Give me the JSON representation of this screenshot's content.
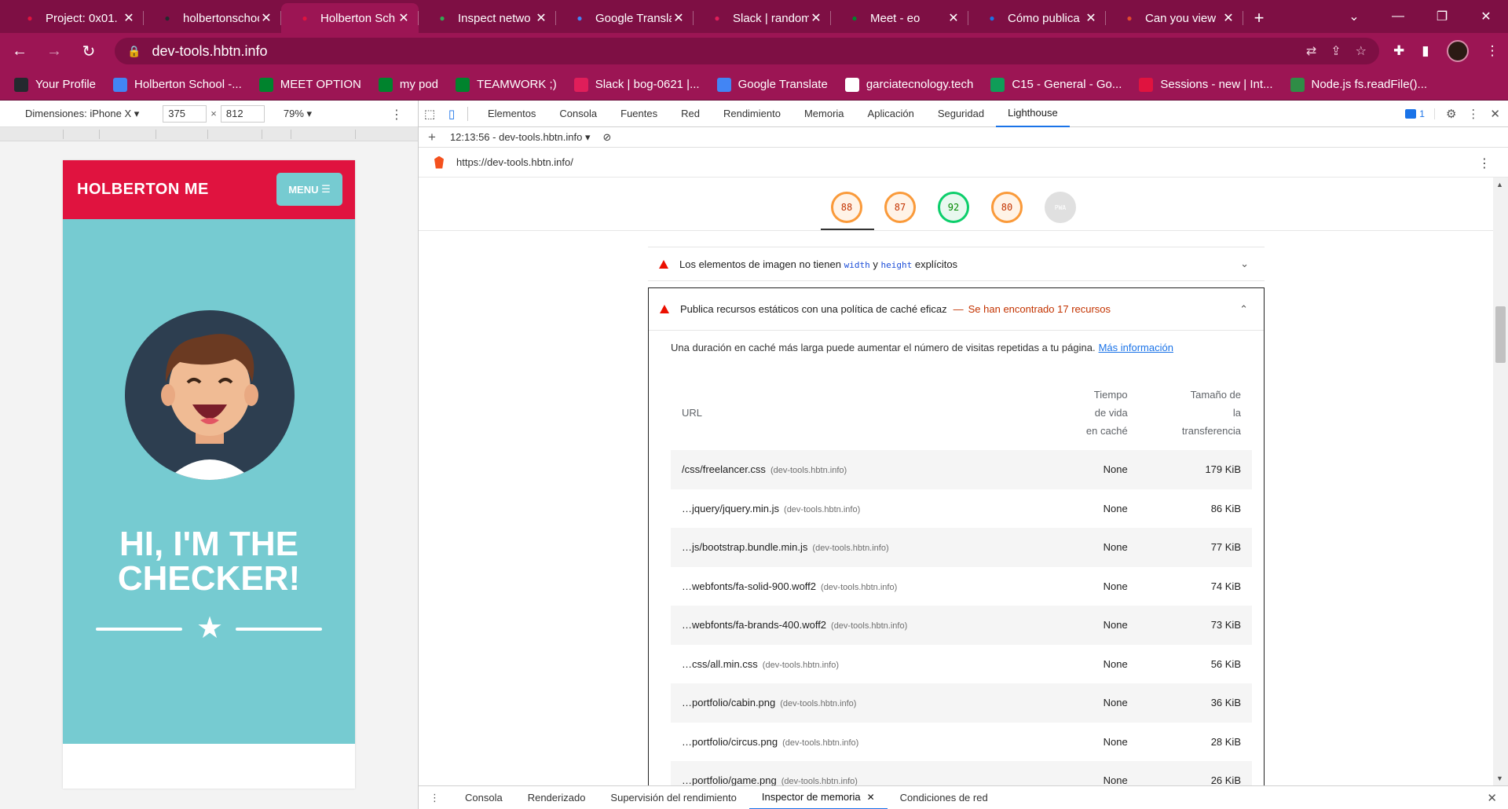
{
  "browser": {
    "tabs": [
      {
        "label": "Project: 0x01. |",
        "favicon": "holberton-icon",
        "color": "#e0133f"
      },
      {
        "label": "holbertonschool",
        "favicon": "github-icon",
        "color": "#24292e"
      },
      {
        "label": "Holberton Sch",
        "favicon": "holberton-icon",
        "color": "#e0133f",
        "active": true
      },
      {
        "label": "Inspect netwo",
        "favicon": "chrome-icon",
        "color": "#34a853"
      },
      {
        "label": "Google Transla",
        "favicon": "translate-icon",
        "color": "#4285f4"
      },
      {
        "label": "Slack | random",
        "favicon": "slack-icon",
        "color": "#e01e5a"
      },
      {
        "label": "Meet - eo",
        "favicon": "meet-icon",
        "color": "#00832d"
      },
      {
        "label": "Cómo publica",
        "favicon": "blue-circle-icon",
        "color": "#1a73e8"
      },
      {
        "label": "Can you view",
        "favicon": "asterisk-icon",
        "color": "#e2492f"
      }
    ],
    "address": "dev-tools.hbtn.info",
    "bookmarks": [
      {
        "label": "Your Profile",
        "icon": "github-icon",
        "color": "#24292e"
      },
      {
        "label": "Holberton School -...",
        "icon": "calendar-icon",
        "color": "#4285f4"
      },
      {
        "label": "MEET OPTION",
        "icon": "meet-icon",
        "color": "#00832d"
      },
      {
        "label": "my pod",
        "icon": "meet-icon",
        "color": "#00832d"
      },
      {
        "label": "TEAMWORK ;)",
        "icon": "meet-icon",
        "color": "#00832d"
      },
      {
        "label": "Slack | bog-0621 |...",
        "icon": "slack-icon",
        "color": "#e01e5a"
      },
      {
        "label": "Google Translate",
        "icon": "translate-icon",
        "color": "#4285f4"
      },
      {
        "label": "garciatecnology.tech",
        "icon": "globe-icon",
        "color": "#ffffff"
      },
      {
        "label": "C15 - General - Go...",
        "icon": "sheets-icon",
        "color": "#0f9d58"
      },
      {
        "label": "Sessions - new | Int...",
        "icon": "holberton-icon",
        "color": "#e0133f"
      },
      {
        "label": "Node.js fs.readFile()...",
        "icon": "geeks-icon",
        "color": "#2f8d46"
      }
    ]
  },
  "device": {
    "label": "Dimensiones: iPhone X",
    "width": "375",
    "height": "812",
    "zoom": "79%"
  },
  "page": {
    "brand": "HOLBERTON ME",
    "menu_label": "MENU",
    "hero_line1": "HI, I'M THE",
    "hero_line2": "CHECKER!"
  },
  "devtools": {
    "tabs": [
      "Elementos",
      "Consola",
      "Fuentes",
      "Red",
      "Rendimiento",
      "Memoria",
      "Aplicación",
      "Seguridad",
      "Lighthouse"
    ],
    "active_tab": "Lighthouse",
    "issues_count": "1",
    "report_label": "12:13:56 - dev-tools.hbtn.info",
    "report_url": "https://dev-tools.hbtn.info/",
    "scores": [
      {
        "value": "88",
        "status": "average"
      },
      {
        "value": "87",
        "status": "average"
      },
      {
        "value": "92",
        "status": "pass"
      },
      {
        "value": "80",
        "status": "average"
      },
      {
        "value": "PWA",
        "status": "na"
      }
    ],
    "audit_closed": {
      "text_before": "Los elementos de imagen no tienen",
      "code1": "width",
      "text_mid": "y",
      "code2": "height",
      "text_after": "explícitos"
    },
    "audit_open": {
      "title": "Publica recursos estáticos con una política de caché eficaz",
      "found": "Se han encontrado 17 recursos",
      "description": "Una duración en caché más larga puede aumentar el número de visitas repetidas a tu página.",
      "link": "Más información",
      "columns": {
        "url": "URL",
        "ttl": [
          "Tiempo",
          "de vida",
          "en caché"
        ],
        "size": [
          "Tamaño de",
          "la",
          "transferencia"
        ]
      },
      "rows": [
        {
          "url": "/css/freelancer.css",
          "host": "(dev-tools.hbtn.info)",
          "ttl": "None",
          "size": "179 KiB"
        },
        {
          "url": "…jquery/jquery.min.js",
          "host": "(dev-tools.hbtn.info)",
          "ttl": "None",
          "size": "86 KiB"
        },
        {
          "url": "…js/bootstrap.bundle.min.js",
          "host": "(dev-tools.hbtn.info)",
          "ttl": "None",
          "size": "77 KiB"
        },
        {
          "url": "…webfonts/fa-solid-900.woff2",
          "host": "(dev-tools.hbtn.info)",
          "ttl": "None",
          "size": "74 KiB"
        },
        {
          "url": "…webfonts/fa-brands-400.woff2",
          "host": "(dev-tools.hbtn.info)",
          "ttl": "None",
          "size": "73 KiB"
        },
        {
          "url": "…css/all.min.css",
          "host": "(dev-tools.hbtn.info)",
          "ttl": "None",
          "size": "56 KiB"
        },
        {
          "url": "…portfolio/cabin.png",
          "host": "(dev-tools.hbtn.info)",
          "ttl": "None",
          "size": "36 KiB"
        },
        {
          "url": "…portfolio/circus.png",
          "host": "(dev-tools.hbtn.info)",
          "ttl": "None",
          "size": "28 KiB"
        },
        {
          "url": "…portfolio/game.png",
          "host": "(dev-tools.hbtn.info)",
          "ttl": "None",
          "size": "26 KiB"
        }
      ]
    },
    "drawer_tabs": [
      "Consola",
      "Renderizado",
      "Supervisión del rendimiento",
      "Inspector de memoria",
      "Condiciones de red"
    ],
    "drawer_active": "Inspector de memoria"
  }
}
